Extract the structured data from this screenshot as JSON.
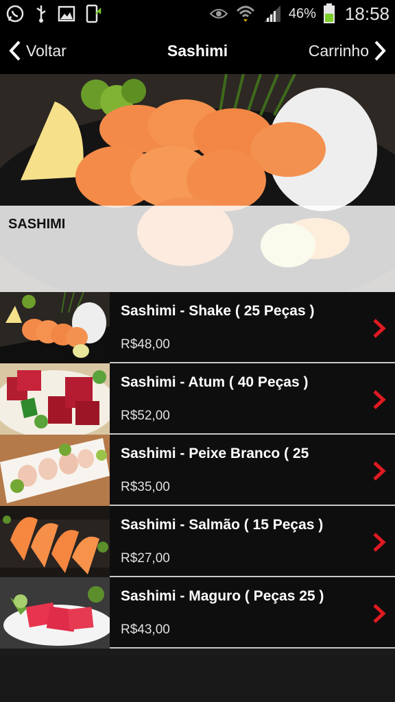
{
  "status_bar": {
    "battery_percent": "46%",
    "time": "18:58",
    "icons": [
      "whatsapp-icon",
      "usb-icon",
      "image-icon",
      "phone-update-icon",
      "eye-icon",
      "wifi-icon",
      "signal-icon",
      "battery-icon"
    ]
  },
  "nav": {
    "back_label": "Voltar",
    "title": "Sashimi",
    "cart_label": "Carrinho"
  },
  "hero": {
    "category_title": "SASHIMI"
  },
  "items": [
    {
      "name": "Sashimi - Shake ( 25 Peças )",
      "price": "R$48,00"
    },
    {
      "name": "Sashimi - Atum ( 40 Peças )",
      "price": "R$52,00"
    },
    {
      "name": "Sashimi - Peixe Branco ( 25",
      "price": "R$35,00"
    },
    {
      "name": "Sashimi - Salmão ( 15 Peças )",
      "price": "R$27,00"
    },
    {
      "name": "Sashimi - Maguro ( Peças 25 )",
      "price": "R$43,00"
    }
  ],
  "colors": {
    "accent": "#e01a22",
    "bar_bg": "#000000",
    "row_bg": "#0e0e0e"
  }
}
